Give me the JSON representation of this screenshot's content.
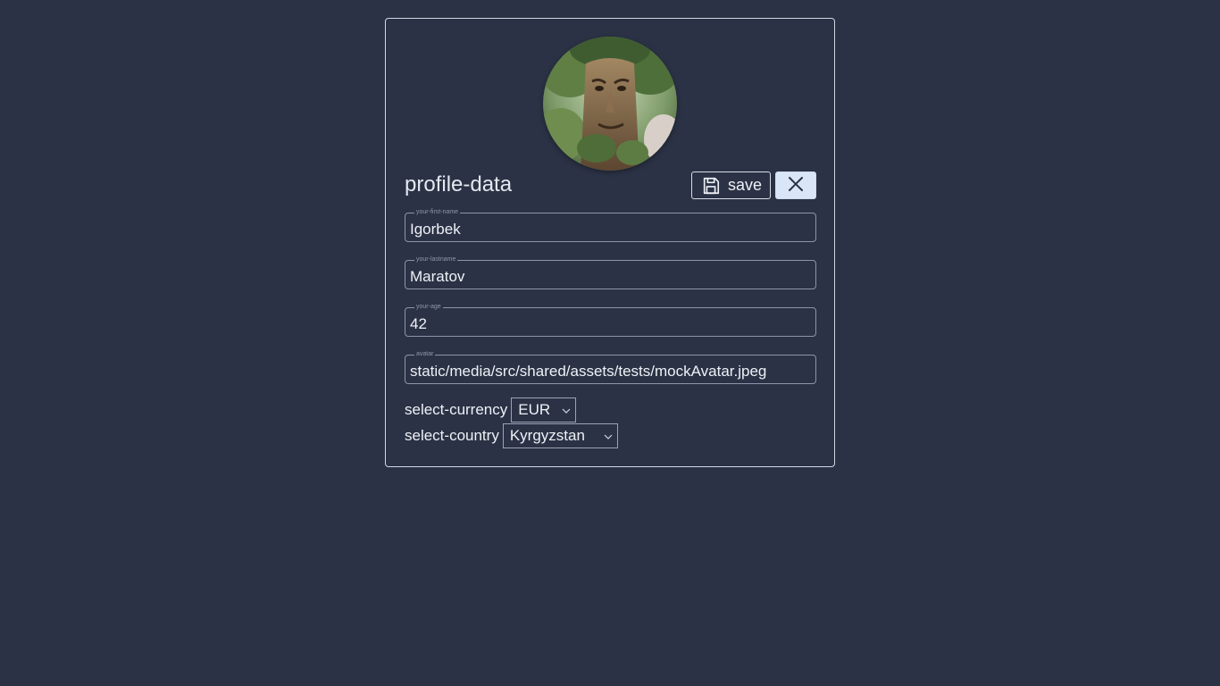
{
  "profile": {
    "title": "profile-data",
    "save_label": "save",
    "avatar_alt": "avatar"
  },
  "fields": [
    {
      "legend": "your-first-name",
      "value": "Igorbek"
    },
    {
      "legend": "your-lastname",
      "value": "Maratov"
    },
    {
      "legend": "your-age",
      "value": "42"
    },
    {
      "legend": "avatar",
      "value": "static/media/src/shared/assets/tests/mockAvatar.jpeg"
    }
  ],
  "selects": {
    "currency": {
      "label": "select-currency",
      "value": "EUR"
    },
    "country": {
      "label": "select-country",
      "value": "Kyrgyzstan"
    }
  },
  "icons": {
    "save": "floppy-disk-icon",
    "close": "close-icon",
    "chevron": "chevron-down-icon"
  },
  "colors": {
    "background": "#2b3245",
    "card_border": "#cfd6e3",
    "close_button_bg": "#d9e6f7"
  }
}
